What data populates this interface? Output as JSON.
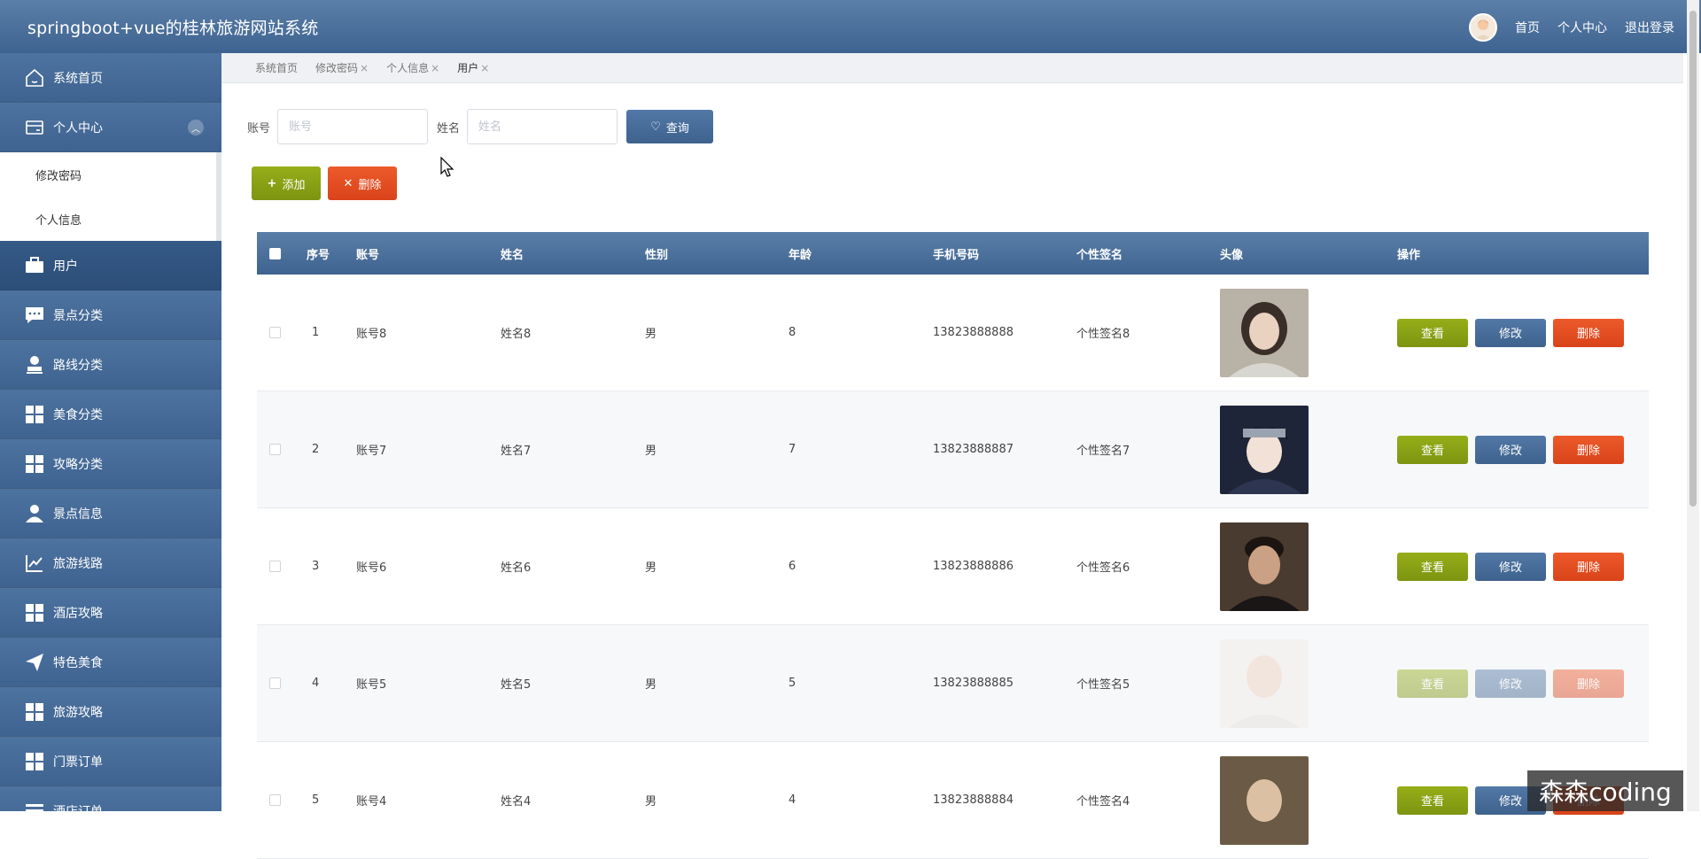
{
  "app": {
    "title": "springboot+vue的桂林旅游网站系统"
  },
  "topbar": {
    "links": [
      "首页",
      "个人中心",
      "退出登录"
    ]
  },
  "sidebar": {
    "items": [
      {
        "label": "系统首页",
        "icon": "home-icon"
      },
      {
        "label": "个人中心",
        "icon": "card-icon"
      },
      {
        "label": "用户",
        "icon": "briefcase-icon"
      },
      {
        "label": "景点分类",
        "icon": "chat-icon"
      },
      {
        "label": "路线分类",
        "icon": "stamp-icon"
      },
      {
        "label": "美食分类",
        "icon": "grid-icon"
      },
      {
        "label": "攻略分类",
        "icon": "grid-icon"
      },
      {
        "label": "景点信息",
        "icon": "user-icon"
      },
      {
        "label": "旅游线路",
        "icon": "chart-icon"
      },
      {
        "label": "酒店攻略",
        "icon": "grid-icon"
      },
      {
        "label": "特色美食",
        "icon": "send-icon"
      },
      {
        "label": "旅游攻略",
        "icon": "grid-icon"
      },
      {
        "label": "门票订单",
        "icon": "grid-icon"
      },
      {
        "label": "酒店订单",
        "icon": "list-icon"
      }
    ],
    "submenu": [
      "修改密码",
      "个人信息"
    ]
  },
  "tabs": [
    "系统首页",
    "修改密码",
    "个人信息",
    "用户"
  ],
  "search": {
    "account_label": "账号",
    "account_placeholder": "账号",
    "name_label": "姓名",
    "name_placeholder": "姓名",
    "query_label": "查询"
  },
  "actions": {
    "add_label": "添加",
    "delete_label": "删除"
  },
  "table": {
    "headers": [
      "序号",
      "账号",
      "姓名",
      "性别",
      "年龄",
      "手机号码",
      "个性签名",
      "头像",
      "操作"
    ],
    "rows": [
      {
        "no": "1",
        "account": "账号8",
        "name": "姓名8",
        "sex": "男",
        "age": "8",
        "phone": "13823888888",
        "sign": "个性签名8"
      },
      {
        "no": "2",
        "account": "账号7",
        "name": "姓名7",
        "sex": "男",
        "age": "7",
        "phone": "13823888887",
        "sign": "个性签名7"
      },
      {
        "no": "3",
        "account": "账号6",
        "name": "姓名6",
        "sex": "男",
        "age": "6",
        "phone": "13823888886",
        "sign": "个性签名6"
      },
      {
        "no": "4",
        "account": "账号5",
        "name": "姓名5",
        "sex": "男",
        "age": "5",
        "phone": "13823888885",
        "sign": "个性签名5"
      },
      {
        "no": "5",
        "account": "账号4",
        "name": "姓名4",
        "sex": "男",
        "age": "4",
        "phone": "13823888884",
        "sign": "个性签名4"
      }
    ],
    "op_labels": {
      "view": "查看",
      "edit": "修改",
      "delete": "删除"
    }
  },
  "watermark": "森森coding"
}
